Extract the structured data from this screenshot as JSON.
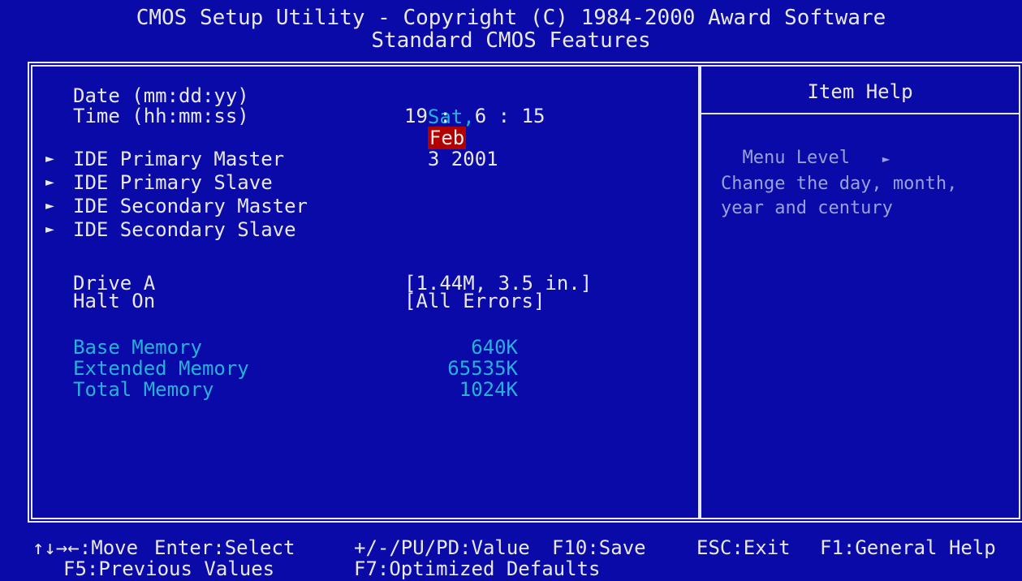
{
  "header": {
    "title": "CMOS Setup Utility - Copyright (C) 1984-2000 Award Software",
    "subtitle": "Standard CMOS Features"
  },
  "settings": {
    "date_label": "Date (mm:dd:yy)",
    "date_day": "Sat,",
    "date_month": "Feb",
    "date_rest": "3 2001",
    "time_label": "Time (hh:mm:ss)",
    "time_value": "19 :  6 : 15",
    "ide": [
      {
        "label": "IDE Primary Master"
      },
      {
        "label": "IDE Primary Slave"
      },
      {
        "label": "IDE Secondary Master"
      },
      {
        "label": "IDE Secondary Slave"
      }
    ],
    "drive_a_label": "Drive A",
    "drive_a_value": "[1.44M, 3.5 in.]",
    "halt_on_label": "Halt On",
    "halt_on_value": "[All Errors]"
  },
  "memory": [
    {
      "label": "Base Memory",
      "value": "640K"
    },
    {
      "label": "Extended Memory",
      "value": "65535K"
    },
    {
      "label": "Total Memory",
      "value": "1024K"
    }
  ],
  "help": {
    "title": "Item Help",
    "menu_level_label": "Menu Level",
    "menu_level_arrow": "►",
    "text_line1": "Change the day, month,",
    "text_line2": "year and century"
  },
  "footer": {
    "move": "↑↓→←:Move",
    "enter": "Enter:Select",
    "value": "+/-/PU/PD:Value",
    "save": "F10:Save",
    "esc": "ESC:Exit",
    "f1": "F1:General Help",
    "f5": "F5:Previous Values",
    "f7": "F7:Optimized Defaults"
  },
  "colors": {
    "background": "#0a0aa8",
    "text": "#e8e8e8",
    "dim_text": "#26b2d6",
    "highlight": "#b00000"
  }
}
